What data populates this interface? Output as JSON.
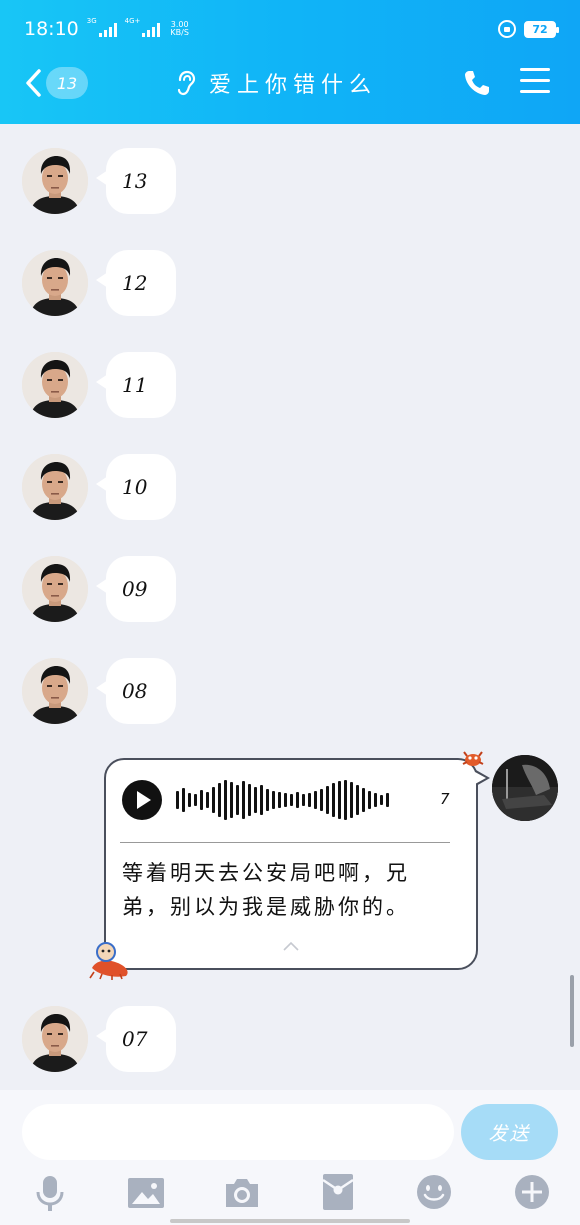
{
  "status_bar": {
    "time": "18:10",
    "sim1": "3G",
    "sim2": "4G+",
    "speed_value": "3.00",
    "speed_unit": "KB/S",
    "battery": "72"
  },
  "header": {
    "back_count": "13",
    "title": "爱上你错什么"
  },
  "messages": [
    {
      "text": "13"
    },
    {
      "text": "12"
    },
    {
      "text": "11"
    },
    {
      "text": "10"
    },
    {
      "text": "09"
    },
    {
      "text": "08"
    },
    {
      "text": "07"
    }
  ],
  "voice_message": {
    "duration": "7",
    "transcript": "等着明天去公安局吧啊，兄弟，别以为我是威胁你的。"
  },
  "input": {
    "placeholder": "",
    "send_label": "发送"
  },
  "toolbar": {
    "icons": [
      "microphone-icon",
      "image-icon",
      "camera-icon",
      "red-packet-icon",
      "emoji-icon",
      "plus-icon"
    ]
  },
  "colors": {
    "header_start": "#18c6f6",
    "header_end": "#0fa6f6",
    "chat_bg": "#eef0f6",
    "send_button": "#a6dcf7",
    "toolbar_icon": "#a9b1bf"
  }
}
